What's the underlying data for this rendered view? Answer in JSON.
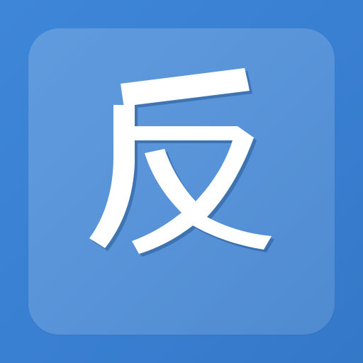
{
  "icon": {
    "character": "反",
    "glyph_icon": "fan-character-icon",
    "colors": {
      "background": "#3a80d2",
      "tile": "#5a97dc",
      "glyph": "#ffffff",
      "glyph_shadow": "#2a5a94"
    }
  }
}
